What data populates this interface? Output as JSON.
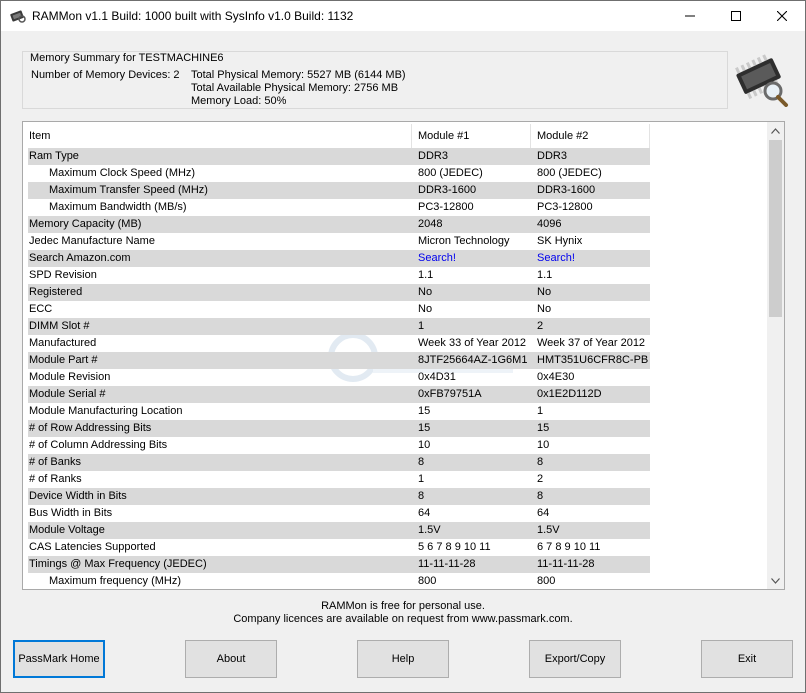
{
  "window": {
    "title": "RAMMon v1.1 Build: 1000 built with SysInfo v1.0 Build: 1132"
  },
  "summary": {
    "title": "Memory Summary for TESTMACHINE6",
    "devices": "Number of Memory Devices: 2",
    "total_physical": "Total Physical Memory: 5527 MB (6144 MB)",
    "total_available": "Total Available Physical Memory: 2756 MB",
    "memory_load": "Memory Load: 50%"
  },
  "table": {
    "headers": [
      "Item",
      "Module #1",
      "Module #2"
    ],
    "rows": [
      {
        "item": "Ram Type",
        "m1": "DDR3",
        "m2": "DDR3",
        "indent": false,
        "link": false
      },
      {
        "item": "Maximum Clock Speed (MHz)",
        "m1": "800 (JEDEC)",
        "m2": "800 (JEDEC)",
        "indent": true,
        "link": false
      },
      {
        "item": "Maximum Transfer Speed (MHz)",
        "m1": "DDR3-1600",
        "m2": "DDR3-1600",
        "indent": true,
        "link": false
      },
      {
        "item": "Maximum Bandwidth (MB/s)",
        "m1": "PC3-12800",
        "m2": "PC3-12800",
        "indent": true,
        "link": false
      },
      {
        "item": "Memory Capacity (MB)",
        "m1": "2048",
        "m2": "4096",
        "indent": false,
        "link": false
      },
      {
        "item": "Jedec Manufacture Name",
        "m1": "Micron Technology",
        "m2": "SK Hynix",
        "indent": false,
        "link": false
      },
      {
        "item": "Search Amazon.com",
        "m1": "Search!",
        "m2": "Search!",
        "indent": false,
        "link": true
      },
      {
        "item": "SPD Revision",
        "m1": "1.1",
        "m2": "1.1",
        "indent": false,
        "link": false
      },
      {
        "item": "Registered",
        "m1": "No",
        "m2": "No",
        "indent": false,
        "link": false
      },
      {
        "item": "ECC",
        "m1": "No",
        "m2": "No",
        "indent": false,
        "link": false
      },
      {
        "item": "DIMM Slot #",
        "m1": "1",
        "m2": "2",
        "indent": false,
        "link": false
      },
      {
        "item": "Manufactured",
        "m1": "Week 33 of Year 2012",
        "m2": "Week 37 of Year 2012",
        "indent": false,
        "link": false
      },
      {
        "item": "Module Part #",
        "m1": "8JTF25664AZ-1G6M1",
        "m2": "HMT351U6CFR8C-PB",
        "indent": false,
        "link": false
      },
      {
        "item": "Module Revision",
        "m1": "0x4D31",
        "m2": "0x4E30",
        "indent": false,
        "link": false
      },
      {
        "item": "Module Serial #",
        "m1": "0xFB79751A",
        "m2": "0x1E2D112D",
        "indent": false,
        "link": false
      },
      {
        "item": "Module Manufacturing Location",
        "m1": "15",
        "m2": "1",
        "indent": false,
        "link": false
      },
      {
        "item": "# of Row Addressing Bits",
        "m1": "15",
        "m2": "15",
        "indent": false,
        "link": false
      },
      {
        "item": "# of Column Addressing Bits",
        "m1": "10",
        "m2": "10",
        "indent": false,
        "link": false
      },
      {
        "item": "# of Banks",
        "m1": "8",
        "m2": "8",
        "indent": false,
        "link": false
      },
      {
        "item": "# of Ranks",
        "m1": "1",
        "m2": "2",
        "indent": false,
        "link": false
      },
      {
        "item": "Device Width in Bits",
        "m1": "8",
        "m2": "8",
        "indent": false,
        "link": false
      },
      {
        "item": "Bus Width in Bits",
        "m1": "64",
        "m2": "64",
        "indent": false,
        "link": false
      },
      {
        "item": "Module Voltage",
        "m1": "1.5V",
        "m2": "1.5V",
        "indent": false,
        "link": false
      },
      {
        "item": "CAS Latencies Supported",
        "m1": "5 6 7 8 9 10 11",
        "m2": "6 7 8 9 10 11",
        "indent": false,
        "link": false
      },
      {
        "item": "Timings @ Max Frequency (JEDEC)",
        "m1": "11-11-11-28",
        "m2": "11-11-11-28",
        "indent": false,
        "link": false
      },
      {
        "item": "Maximum frequency (MHz)",
        "m1": "800",
        "m2": "800",
        "indent": true,
        "link": false
      }
    ]
  },
  "footer": {
    "line1": "RAMMon is free for personal use.",
    "line2": "Company licences are available on request from www.passmark.com."
  },
  "buttons": {
    "passmark_home": "PassMark Home",
    "about": "About",
    "help": "Help",
    "export_copy": "Export/Copy",
    "exit": "Exit"
  },
  "colors": {
    "shade_row": "#d9d9d9",
    "link": "#0000ee",
    "default_button_border": "#0078d7"
  }
}
